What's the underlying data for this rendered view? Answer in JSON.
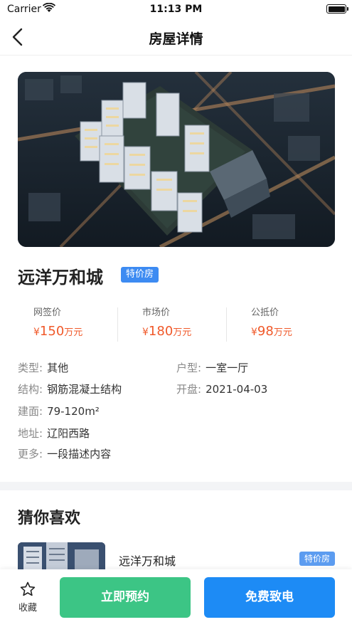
{
  "status_bar": {
    "carrier": "Carrier",
    "time": "11:13 PM"
  },
  "nav": {
    "title": "房屋详情"
  },
  "property": {
    "name": "远洋万和城",
    "tag": "特价房",
    "prices": [
      {
        "label": "网签价",
        "currency": "¥",
        "amount": "150",
        "unit": "万元"
      },
      {
        "label": "市场价",
        "currency": "¥",
        "amount": "180",
        "unit": "万元"
      },
      {
        "label": "公抵价",
        "currency": "¥",
        "amount": "98",
        "unit": "万元"
      }
    ],
    "info": {
      "type_label": "类型:",
      "type_value": "其他",
      "layout_label": "户型:",
      "layout_value": "一室一厅",
      "structure_label": "结构:",
      "structure_value": "钢筋混凝土结构",
      "open_label": "开盘:",
      "open_value": "2021-04-03",
      "area_label": "建面:",
      "area_value": "79-120m²",
      "address_label": "地址:",
      "address_value": "辽阳西路",
      "more_label": "更多:",
      "more_value": "一段描述内容"
    }
  },
  "guess": {
    "title": "猜你喜欢",
    "items": [
      {
        "name": "远洋万和城",
        "tag": "特价房"
      }
    ]
  },
  "bottom_bar": {
    "favorite_label": "收藏",
    "book_label": "立即预约",
    "call_label": "免费致电"
  },
  "colors": {
    "price": "#f0592a",
    "tag": "#3d8bf2",
    "book": "#3cc585",
    "call": "#1d8bf5"
  },
  "icons": {
    "back": "chevron-left-icon",
    "favorite": "star-icon",
    "wifi": "wifi-icon",
    "battery": "battery-icon"
  }
}
